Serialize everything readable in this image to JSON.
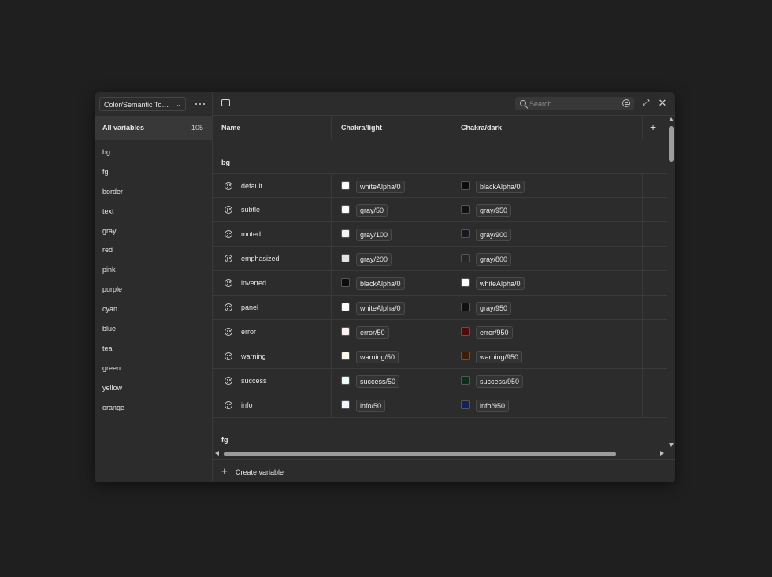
{
  "sidebar": {
    "collection": "Color/Semantic Tokens",
    "all_variables_label": "All variables",
    "all_variables_count": "105",
    "groups": [
      "bg",
      "fg",
      "border",
      "text",
      "gray",
      "red",
      "pink",
      "purple",
      "cyan",
      "blue",
      "teal",
      "green",
      "yellow",
      "orange"
    ]
  },
  "toolbar": {
    "search_placeholder": "Search"
  },
  "table": {
    "headers": {
      "name": "Name",
      "light": "Chakra/light",
      "dark": "Chakra/dark"
    },
    "group_bg": "bg",
    "group_fg": "fg",
    "rows": [
      {
        "name": "default",
        "light": "whiteAlpha/0",
        "light_color": "#ffffff",
        "dark": "blackAlpha/0",
        "dark_color": "#0d0d0d"
      },
      {
        "name": "subtle",
        "light": "gray/50",
        "light_color": "#fafafa",
        "dark": "gray/950",
        "dark_color": "#111111"
      },
      {
        "name": "muted",
        "light": "gray/100",
        "light_color": "#f4f4f5",
        "dark": "gray/900",
        "dark_color": "#18181f"
      },
      {
        "name": "emphasized",
        "light": "gray/200",
        "light_color": "#e4e4e7",
        "dark": "gray/800",
        "dark_color": "#27272a"
      },
      {
        "name": "inverted",
        "light": "blackAlpha/0",
        "light_color": "#0d0d0d",
        "dark": "whiteAlpha/0",
        "dark_color": "#ffffff"
      },
      {
        "name": "panel",
        "light": "whiteAlpha/0",
        "light_color": "#ffffff",
        "dark": "gray/950",
        "dark_color": "#111111"
      },
      {
        "name": "error",
        "light": "error/50",
        "light_color": "#fef2f2",
        "dark": "error/950",
        "dark_color": "#4f0a0a"
      },
      {
        "name": "warning",
        "light": "warning/50",
        "light_color": "#fff8ec",
        "dark": "warning/950",
        "dark_color": "#3b1d06"
      },
      {
        "name": "success",
        "light": "success/50",
        "light_color": "#f0fdf4",
        "dark": "success/950",
        "dark_color": "#0a2e16"
      },
      {
        "name": "info",
        "light": "info/50",
        "light_color": "#eff6ff",
        "dark": "info/950",
        "dark_color": "#14215e"
      }
    ]
  },
  "footer": {
    "create_label": "Create variable"
  }
}
